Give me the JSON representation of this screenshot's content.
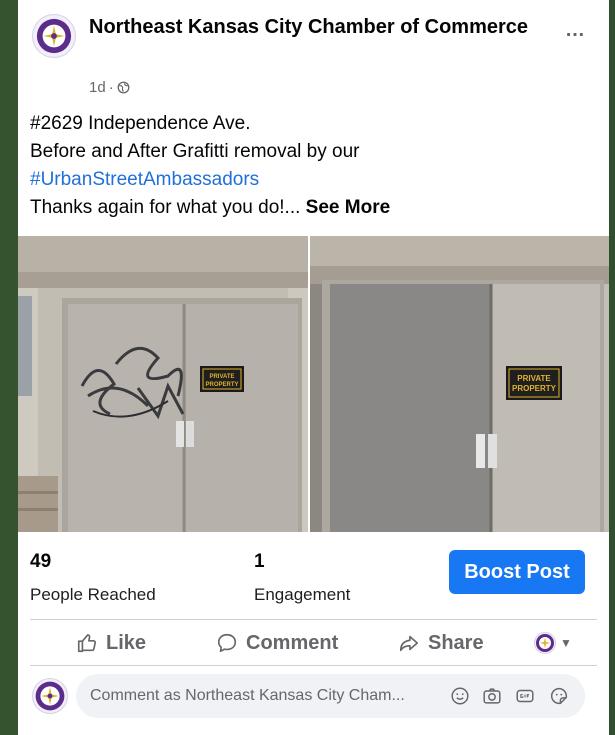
{
  "post": {
    "page_name": "Northeast Kansas City Chamber of Commerce",
    "time": "1d",
    "separator": "·",
    "text": {
      "line1": "#2629 Independence Ave.",
      "line2": "Before and After Grafitti removal by our",
      "hashtag": "#UrbanStreetAmbassadors",
      "line4": "Thanks again for what you do!...",
      "see_more": "See More"
    },
    "more_label": "…",
    "photos": [
      {
        "alt": "Before"
      },
      {
        "alt": "After"
      }
    ],
    "sign_text": [
      "PRIVATE",
      "PROPERTY"
    ]
  },
  "stats": {
    "reached_value": "49",
    "reached_label": "People Reached",
    "engagement_value": "1",
    "engagement_label": "Engagement",
    "boost_label": "Boost Post"
  },
  "actions": {
    "like": "Like",
    "comment": "Comment",
    "share": "Share"
  },
  "comment_box": {
    "placeholder": "Comment as Northeast Kansas City Cham..."
  },
  "colors": {
    "brand_blue": "#1877f2",
    "hashtag": "#216fdb",
    "chamber_purple": "#5b2c8a",
    "chamber_gold": "#e0b12c"
  }
}
